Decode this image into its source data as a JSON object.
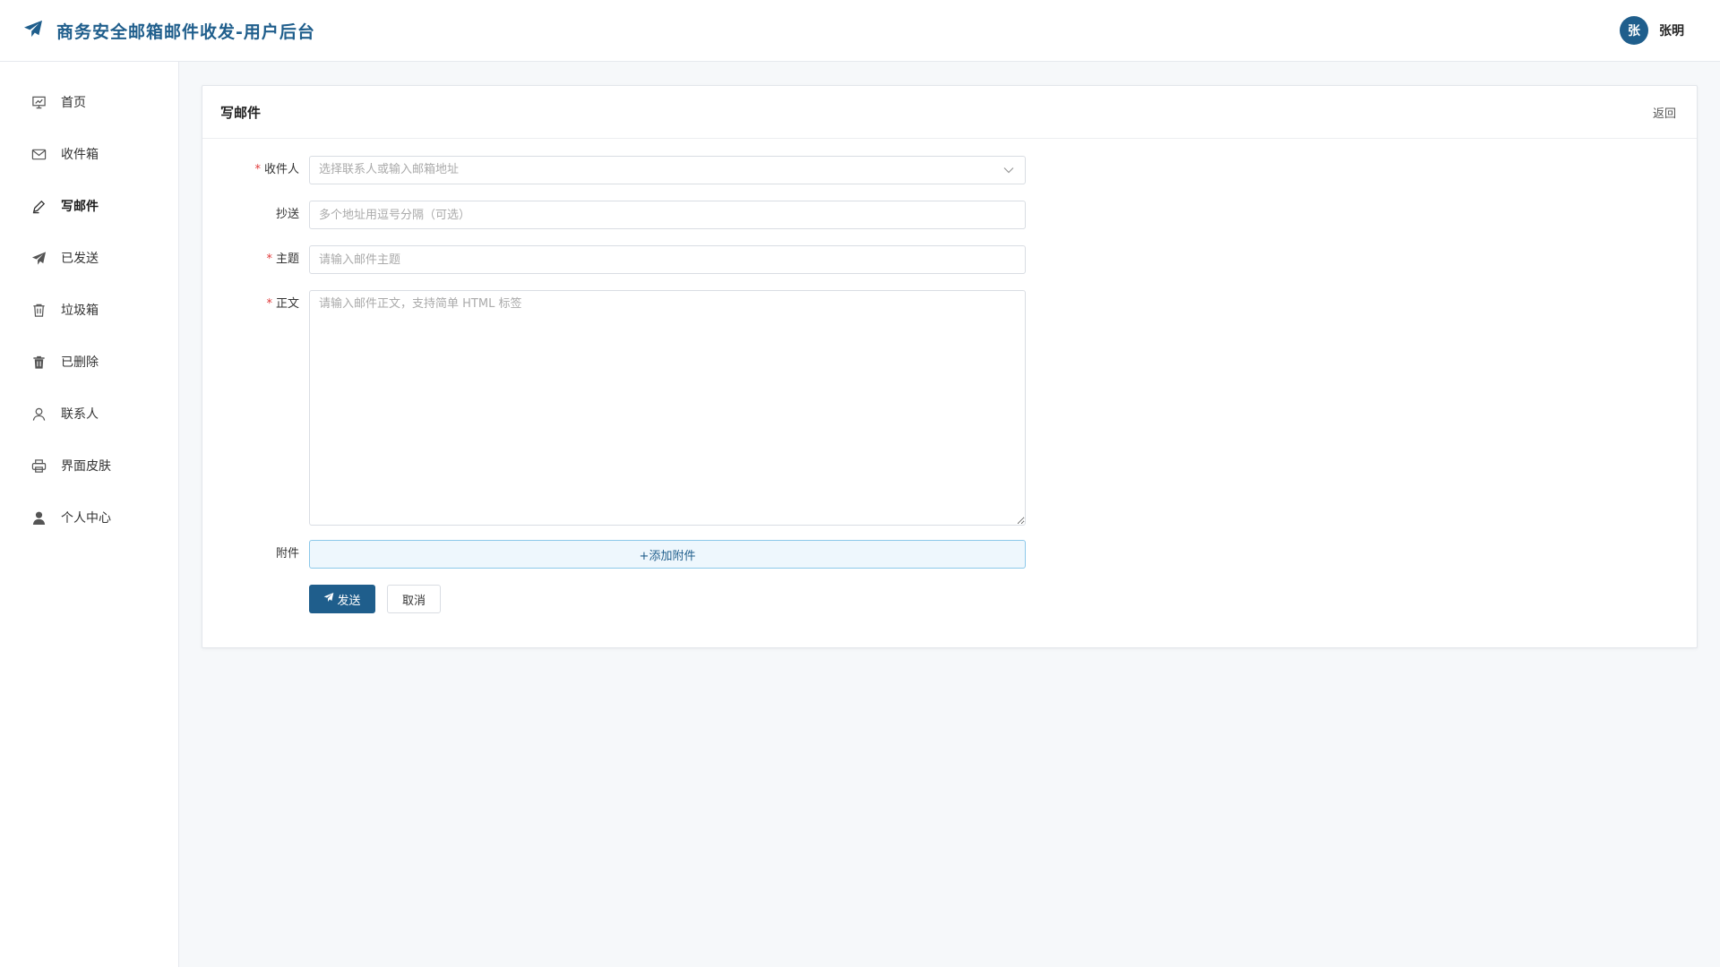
{
  "header": {
    "title": "商务安全邮箱邮件收发-用户后台",
    "logo_icon": "paper-plane-icon",
    "user": {
      "avatar_text": "张",
      "name": "张明"
    }
  },
  "sidebar": {
    "items": [
      {
        "label": "首页",
        "icon": "dashboard-icon",
        "active": false
      },
      {
        "label": "收件箱",
        "icon": "envelope-icon",
        "active": false
      },
      {
        "label": "写邮件",
        "icon": "pen-icon",
        "active": true
      },
      {
        "label": "已发送",
        "icon": "paper-plane-icon",
        "active": false
      },
      {
        "label": "垃圾箱",
        "icon": "trash-outline-icon",
        "active": false
      },
      {
        "label": "已删除",
        "icon": "trash-filled-icon",
        "active": false
      },
      {
        "label": "联系人",
        "icon": "user-outline-icon",
        "active": false
      },
      {
        "label": "界面皮肤",
        "icon": "printer-icon",
        "active": false
      },
      {
        "label": "个人中心",
        "icon": "user-filled-icon",
        "active": false
      }
    ]
  },
  "compose": {
    "title": "写邮件",
    "back_label": "返回",
    "to": {
      "label": "收件人",
      "required": true,
      "placeholder": "选择联系人或输入邮箱地址"
    },
    "cc": {
      "label": "抄送",
      "required": false,
      "placeholder": "多个地址用逗号分隔（可选）"
    },
    "subject": {
      "label": "主题",
      "required": true,
      "placeholder": "请输入邮件主题"
    },
    "body": {
      "label": "正文",
      "required": true,
      "placeholder": "请输入邮件正文，支持简单 HTML 标签"
    },
    "attachment": {
      "label": "附件",
      "button_label": "+添加附件"
    },
    "send_label": "发送",
    "cancel_label": "取消"
  },
  "colors": {
    "accent": "#1f5e8c",
    "required": "#e03a3a",
    "page_background": "#f6f8fa"
  }
}
